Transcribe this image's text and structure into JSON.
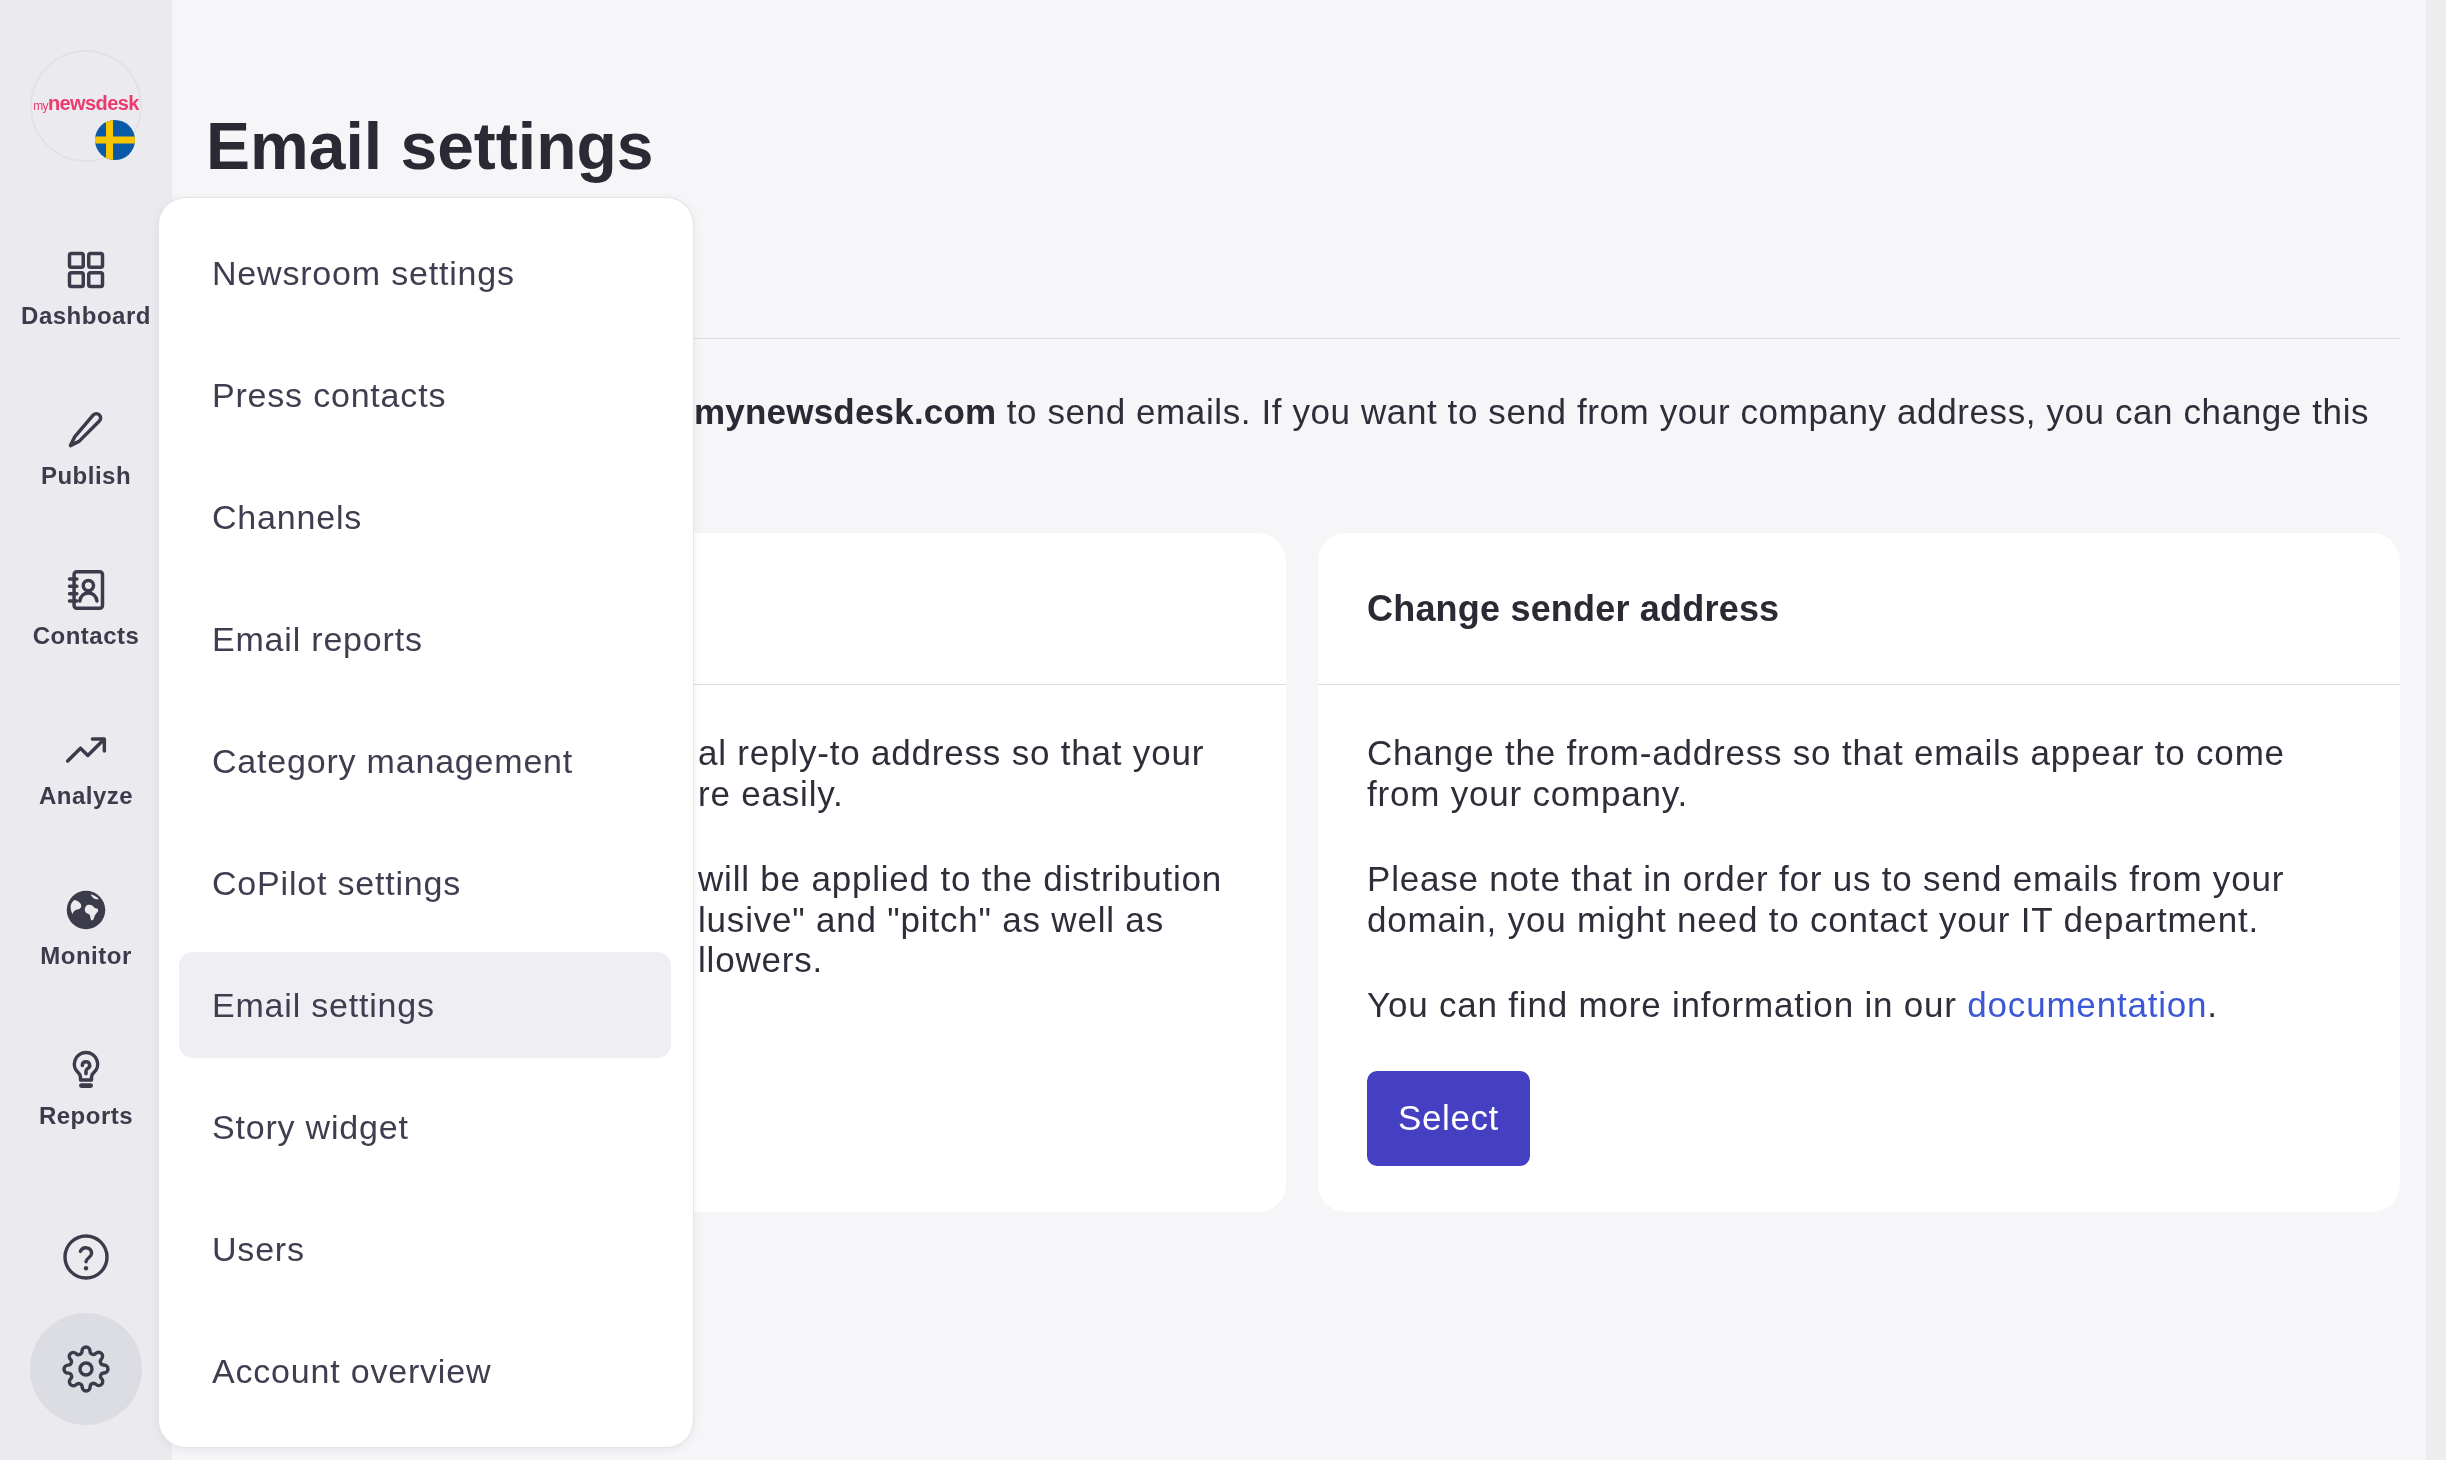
{
  "sidebar": {
    "logo": {
      "wordmark": "my**newsdesk**"
    },
    "nav": [
      {
        "label": "Dashboard",
        "selected": false
      },
      {
        "label": "Publish",
        "selected": false
      },
      {
        "label": "Contacts",
        "selected": false
      },
      {
        "label": "Analyze",
        "selected": false
      },
      {
        "label": "Monitor",
        "selected": false
      },
      {
        "label": "Reports",
        "selected": false
      }
    ],
    "tools": [
      {
        "selected": false
      },
      {
        "selected": true
      }
    ]
  },
  "page": {
    "title": "Email settings",
    "intro": "**mynewsdesk.com** to send emails. If you want to send from your company address, you can change this",
    "cards": [
      {
        "kind": "covered",
        "paragraphs": [
          {
            "lines": [
              "al reply-to address so that your",
              "re easily."
            ]
          },
          {
            "lines": [
              "will be applied to the distribution",
              "lusive\" and \"pitch\" as well as",
              "llowers."
            ]
          }
        ]
      },
      {
        "kind": "full",
        "title": "Change sender address",
        "paragraphs": [
          {
            "text": "Change the from-address so that emails appear to come from your company."
          },
          {
            "text": "Please note that in order for us to send emails from your domain, you might need to contact your IT department."
          },
          {
            "text": "You can find more information in our ",
            "link": "documentation",
            "after": "."
          }
        ],
        "button": "Select"
      }
    ]
  },
  "settings_menu": {
    "items": [
      {
        "label": "Newsroom settings",
        "selected": false
      },
      {
        "label": "Press contacts",
        "selected": false
      },
      {
        "label": "Channels",
        "selected": false
      },
      {
        "label": "Email reports",
        "selected": false
      },
      {
        "label": "Category management",
        "selected": false
      },
      {
        "label": "CoPilot settings",
        "selected": false
      },
      {
        "label": "Email settings",
        "selected": true
      },
      {
        "label": "Story widget",
        "selected": false
      },
      {
        "label": "Users",
        "selected": false
      },
      {
        "label": "Account overview",
        "selected": false
      }
    ]
  }
}
